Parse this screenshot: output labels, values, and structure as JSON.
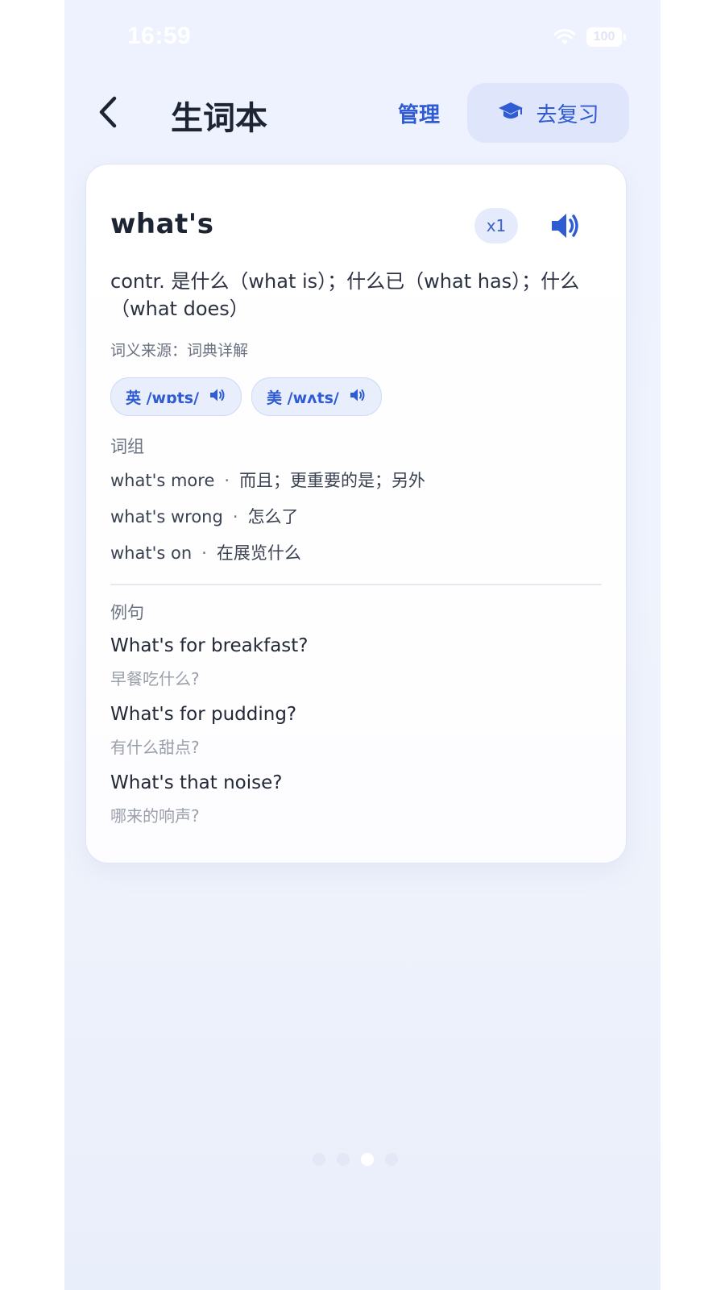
{
  "status_bar": {
    "time": "16:59",
    "battery": "100"
  },
  "header": {
    "title": "生词本",
    "manage_label": "管理",
    "review_label": "去复习"
  },
  "card": {
    "word": "what's",
    "count_badge": "x1",
    "definition": "contr. 是什么（what is）；什么已（what has）；什么（what does）",
    "source": "词义来源：词典详解",
    "phonetics": [
      {
        "text": "英 /wɒts/"
      },
      {
        "text": "美 /wʌts/"
      }
    ],
    "phrases_label": "词组",
    "phrases": [
      {
        "en": "what's more",
        "sep": "·",
        "zh": "而且；更重要的是；另外"
      },
      {
        "en": "what's wrong",
        "sep": "·",
        "zh": "怎么了"
      },
      {
        "en": "what's on",
        "sep": "·",
        "zh": "在展览什么"
      }
    ],
    "examples_label": "例句",
    "examples": [
      {
        "en": "What's for breakfast?",
        "zh": "早餐吃什么?"
      },
      {
        "en": "What's for pudding?",
        "zh": "有什么甜点?"
      },
      {
        "en": "What's that noise?",
        "zh": "哪来的响声?"
      }
    ]
  },
  "pager": {
    "active_index": 3,
    "total": 4
  },
  "colors": {
    "accent": "#2f5bd3",
    "text_primary": "#1d2433",
    "background": "#eef2fe"
  }
}
